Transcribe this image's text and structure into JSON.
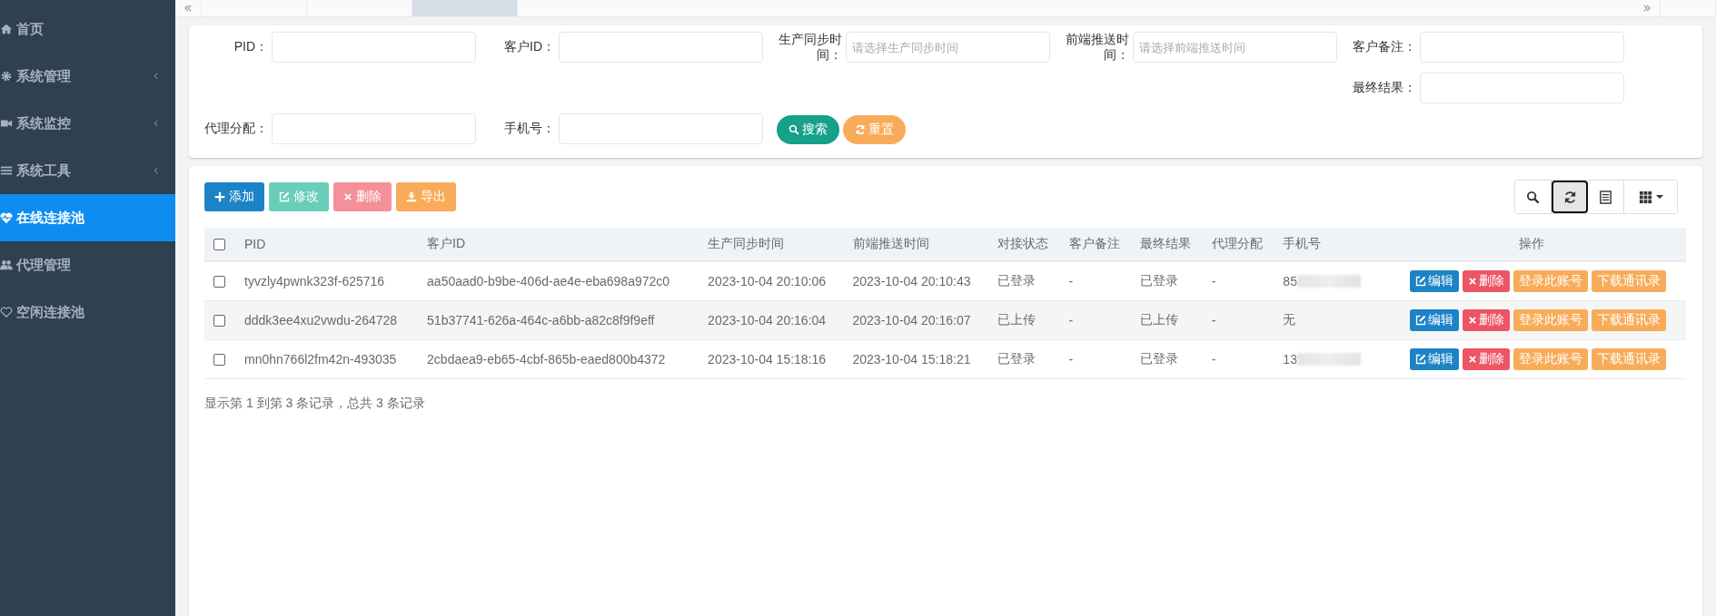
{
  "tabs": [
    {
      "selected": false
    },
    {
      "selected": false
    },
    {
      "selected": true
    }
  ],
  "sidebar": {
    "items": [
      {
        "label": "首页",
        "expandable": false,
        "selected": false
      },
      {
        "label": "系统管理",
        "expandable": true,
        "selected": false
      },
      {
        "label": "系统监控",
        "expandable": true,
        "selected": false
      },
      {
        "label": "系统工具",
        "expandable": true,
        "selected": false
      },
      {
        "label": "在线连接池",
        "expandable": false,
        "selected": true
      },
      {
        "label": "代理管理",
        "expandable": false,
        "selected": false
      },
      {
        "label": "空闲连接池",
        "expandable": false,
        "selected": false
      }
    ]
  },
  "search_form": {
    "fields": [
      {
        "label": "PID："
      },
      {
        "label": "客户ID："
      },
      {
        "label": "生产同步时间：",
        "placeholder": "请选择生产同步时间"
      },
      {
        "label": "前端推送时间：",
        "placeholder": "请选择前端推送时间"
      },
      {
        "label": "客户备注："
      },
      {
        "label": "最终结果："
      },
      {
        "label": "代理分配："
      },
      {
        "label": "手机号："
      }
    ],
    "buttons": [
      {
        "label": "搜索",
        "kind": "search"
      },
      {
        "label": "重置",
        "kind": "reset"
      }
    ]
  },
  "toolbar": {
    "buttons": [
      {
        "label": "添加",
        "kind": "add",
        "disabled": false
      },
      {
        "label": "修改",
        "kind": "edit",
        "disabled": true
      },
      {
        "label": "删除",
        "kind": "delete",
        "disabled": true
      },
      {
        "label": "导出",
        "kind": "export",
        "disabled": false
      }
    ],
    "tools": [
      {
        "kind": "search",
        "focused": false
      },
      {
        "kind": "refresh",
        "focused": true
      },
      {
        "kind": "list",
        "focused": false
      },
      {
        "kind": "columns",
        "focused": false
      }
    ]
  },
  "table": {
    "all_checked": false,
    "columns": [
      "PID",
      "客户ID",
      "生产同步时间",
      "前端推送时间",
      "对接状态",
      "客户备注",
      "最终结果",
      "代理分配",
      "手机号",
      "操作"
    ],
    "rows": [
      {
        "checked": false,
        "highlighted": false,
        "phone_redacted": true,
        "cells": [
          "tyvzly4pwnk323f-625716",
          "aa50aad0-b9be-406d-ae4e-eba698a972c0",
          "2023-10-04 20:10:06",
          "2023-10-04 20:10:43",
          "已登录",
          "-",
          "已登录",
          "-",
          "85"
        ],
        "actions": [
          {
            "label": "编辑",
            "kind": "edit"
          },
          {
            "label": "删除",
            "kind": "delete"
          },
          {
            "label": "登录此账号",
            "kind": "login"
          },
          {
            "label": "下载通讯录",
            "kind": "download"
          }
        ]
      },
      {
        "checked": false,
        "highlighted": true,
        "phone_redacted": false,
        "cells": [
          "dddk3ee4xu2vwdu-264728",
          "51b37741-626a-464c-a6bb-a82c8f9f9eff",
          "2023-10-04 20:16:04",
          "2023-10-04 20:16:07",
          "已上传",
          "-",
          "已上传",
          "-",
          "无"
        ],
        "actions": [
          {
            "label": "编辑",
            "kind": "edit"
          },
          {
            "label": "删除",
            "kind": "delete"
          },
          {
            "label": "登录此账号",
            "kind": "login"
          },
          {
            "label": "下载通讯录",
            "kind": "download"
          }
        ]
      },
      {
        "checked": false,
        "highlighted": false,
        "phone_redacted": true,
        "cells": [
          "mn0hn766l2fm42n-493035",
          "2cbdaea9-eb65-4cbf-865b-eaed800b4372",
          "2023-10-04 15:18:16",
          "2023-10-04 15:18:21",
          "已登录",
          "-",
          "已登录",
          "-",
          "13"
        ],
        "actions": [
          {
            "label": "编辑",
            "kind": "edit"
          },
          {
            "label": "删除",
            "kind": "delete"
          },
          {
            "label": "登录此账号",
            "kind": "login"
          },
          {
            "label": "下载通讯录",
            "kind": "download"
          }
        ]
      }
    ]
  },
  "pagination_info": "显示第 1 到第 3 条记录，总共 3 条记录"
}
